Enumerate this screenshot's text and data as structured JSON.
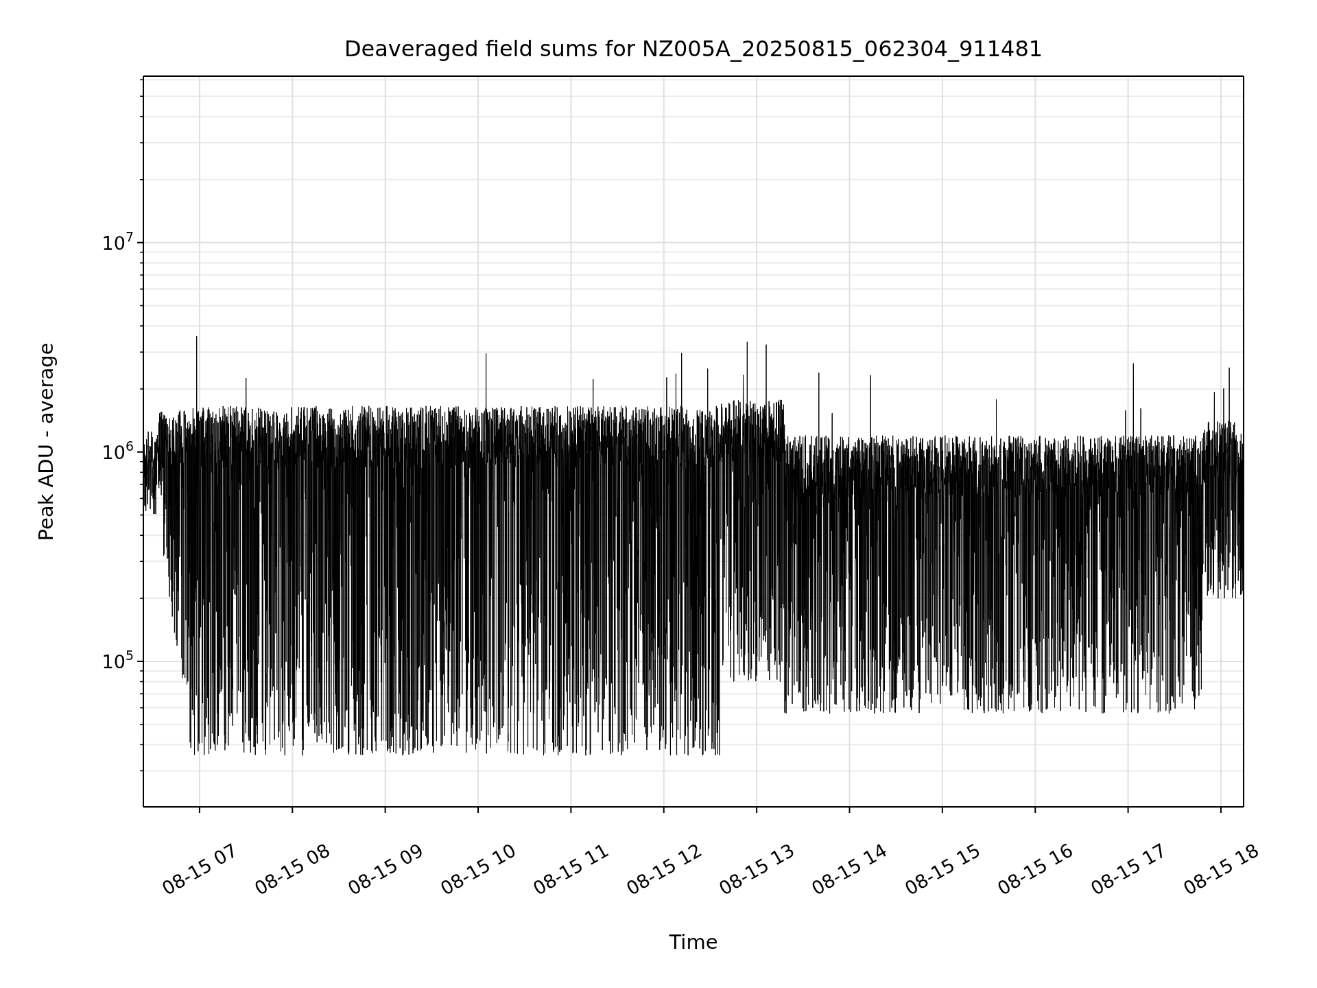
{
  "plot": {
    "title": "Deaveraged field sums for NZ005A_20250815_062304_911481",
    "x_axis": {
      "label": "Time",
      "ticks": [
        "08-15 07",
        "08-15 08",
        "08-15 09",
        "08-15 10",
        "08-15 11",
        "08-15 12",
        "08-15 13",
        "08-15 14",
        "08-15 15",
        "08-15 16",
        "08-15 17",
        "08-15 18"
      ]
    },
    "y_axis": {
      "label": "Peak ADU - average",
      "ticks": [
        "10$^{7}$",
        "10$^{6}$",
        "10$^{5}$"
      ]
    }
  }
}
